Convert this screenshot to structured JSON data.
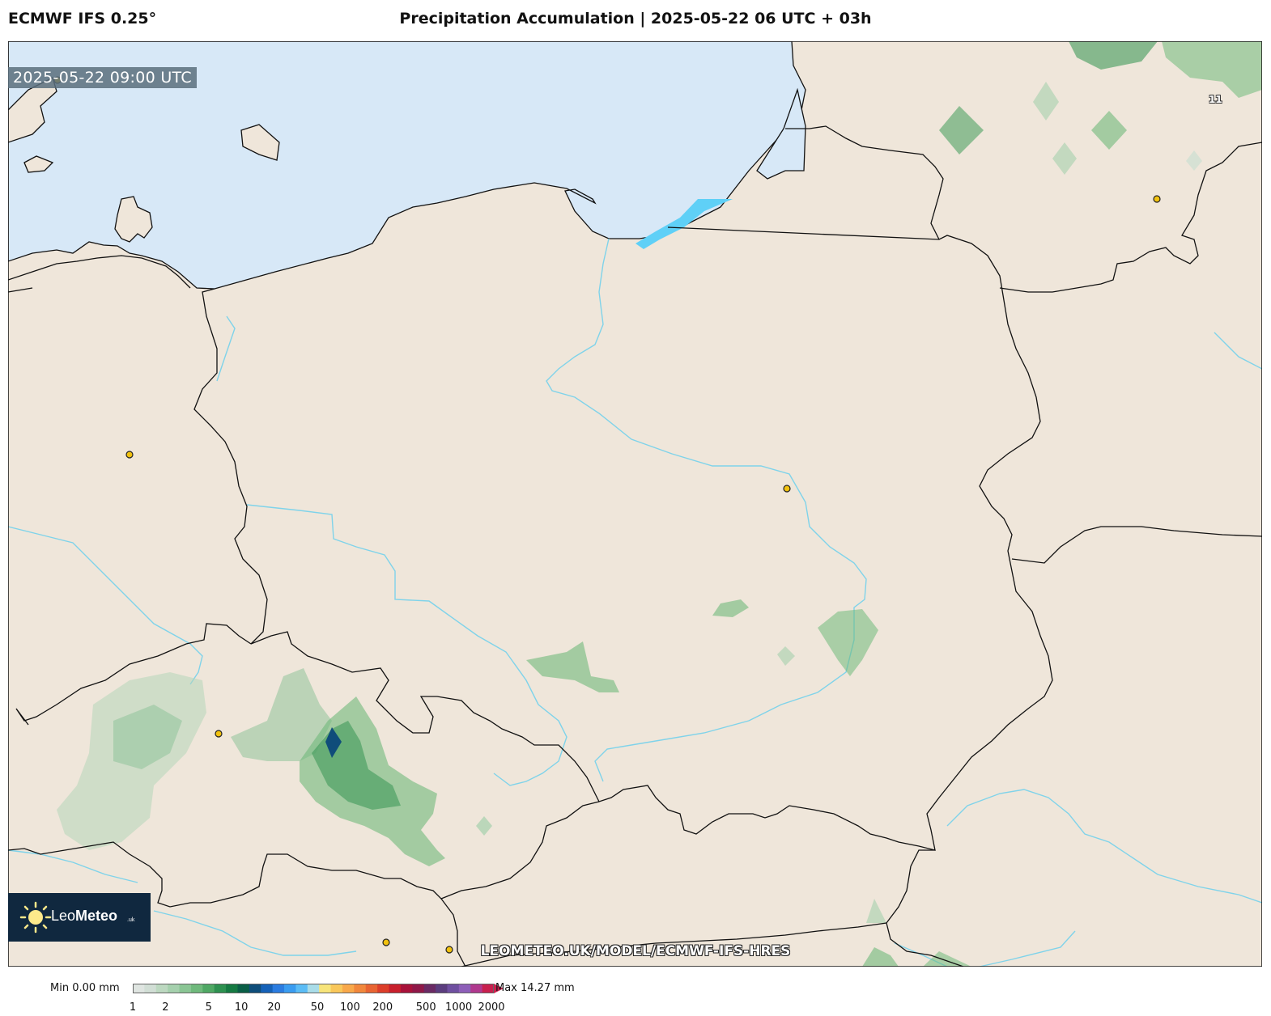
{
  "header": {
    "model": "ECMWF IFS 0.25°",
    "title": "Precipitation Accumulation | 2025-05-22 06 UTC + 03h"
  },
  "map": {
    "valid_time": "2025-05-22 09:00 UTC",
    "grid_label": "11",
    "watermark": "LEOMETEO.UK/MODEL/ECMWF-IFS-HRES",
    "colors": {
      "land": "#efe6da",
      "sea": "#d7e8f7",
      "border": "#111111",
      "river": "#7fd3ea",
      "lagoon": "#5fd0f7",
      "city": "#f2c20f"
    }
  },
  "logo": {
    "brand_light": "Leo",
    "brand_bold": "Meteo",
    "tld": ".uk",
    "icon": "sun-icon"
  },
  "colorbar": {
    "min_label": "Min 0.00 mm",
    "max_label": "Max 14.27 mm",
    "ticks": [
      "1",
      "2",
      "5",
      "10",
      "20",
      "50",
      "100",
      "200",
      "500",
      "1000",
      "2000"
    ],
    "colors": [
      "#dfe5e1",
      "#d1ded5",
      "#bcd8c0",
      "#a5d0ad",
      "#8ac594",
      "#6fb97c",
      "#4fa864",
      "#2e9150",
      "#157a42",
      "#0a5e46",
      "#0f4d7a",
      "#1561b8",
      "#2b7ce0",
      "#3a9cf0",
      "#5bbcf5",
      "#a9dce8",
      "#f7e47a",
      "#f9c75a",
      "#f8a84a",
      "#f1873c",
      "#e86432",
      "#dc3e2a",
      "#c81f2c",
      "#a8123a",
      "#8f1848",
      "#6a2a64",
      "#5b3d7e",
      "#6f4fa0",
      "#8d5eb8",
      "#b0398e",
      "#c8204e"
    ]
  }
}
